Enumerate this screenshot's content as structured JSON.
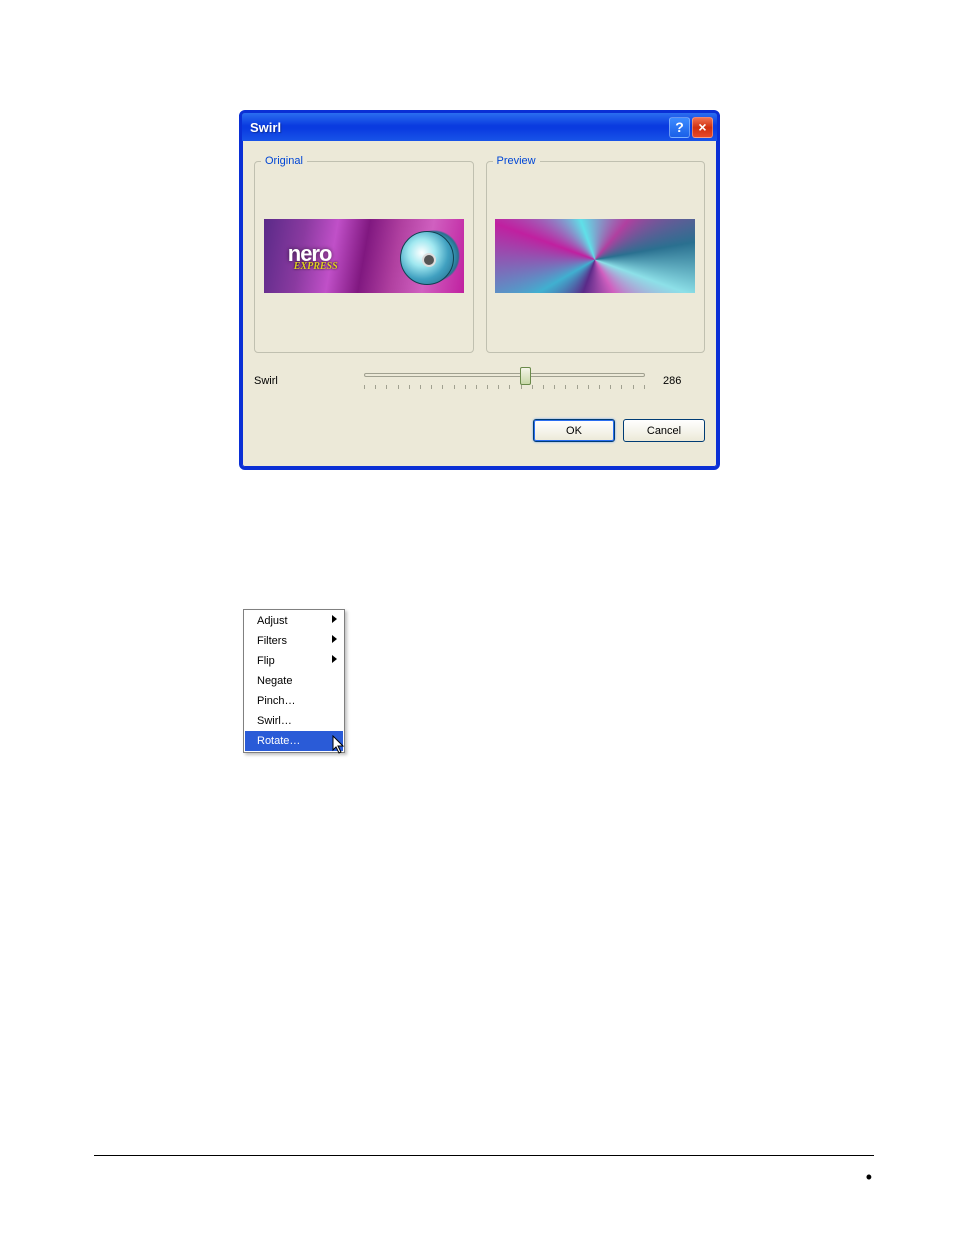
{
  "dialog": {
    "title": "Swirl",
    "original_label": "Original",
    "preview_label": "Preview",
    "slider_label": "Swirl",
    "slider_value": "286",
    "slider_min": 0,
    "slider_max": 500,
    "ok_label": "OK",
    "cancel_label": "Cancel",
    "help_tooltip": "?",
    "close_tooltip": "×"
  },
  "context_menu": {
    "items": [
      {
        "label": "Adjust",
        "submenu": true,
        "selected": false
      },
      {
        "label": "Filters",
        "submenu": true,
        "selected": false
      },
      {
        "label": "Flip",
        "submenu": true,
        "selected": false
      },
      {
        "label": "Negate",
        "submenu": false,
        "selected": false
      },
      {
        "label": "Pinch…",
        "submenu": false,
        "selected": false
      },
      {
        "label": "Swirl…",
        "submenu": false,
        "selected": false
      },
      {
        "label": "Rotate…",
        "submenu": false,
        "selected": true
      }
    ]
  },
  "footer": {
    "bullet": "•"
  }
}
